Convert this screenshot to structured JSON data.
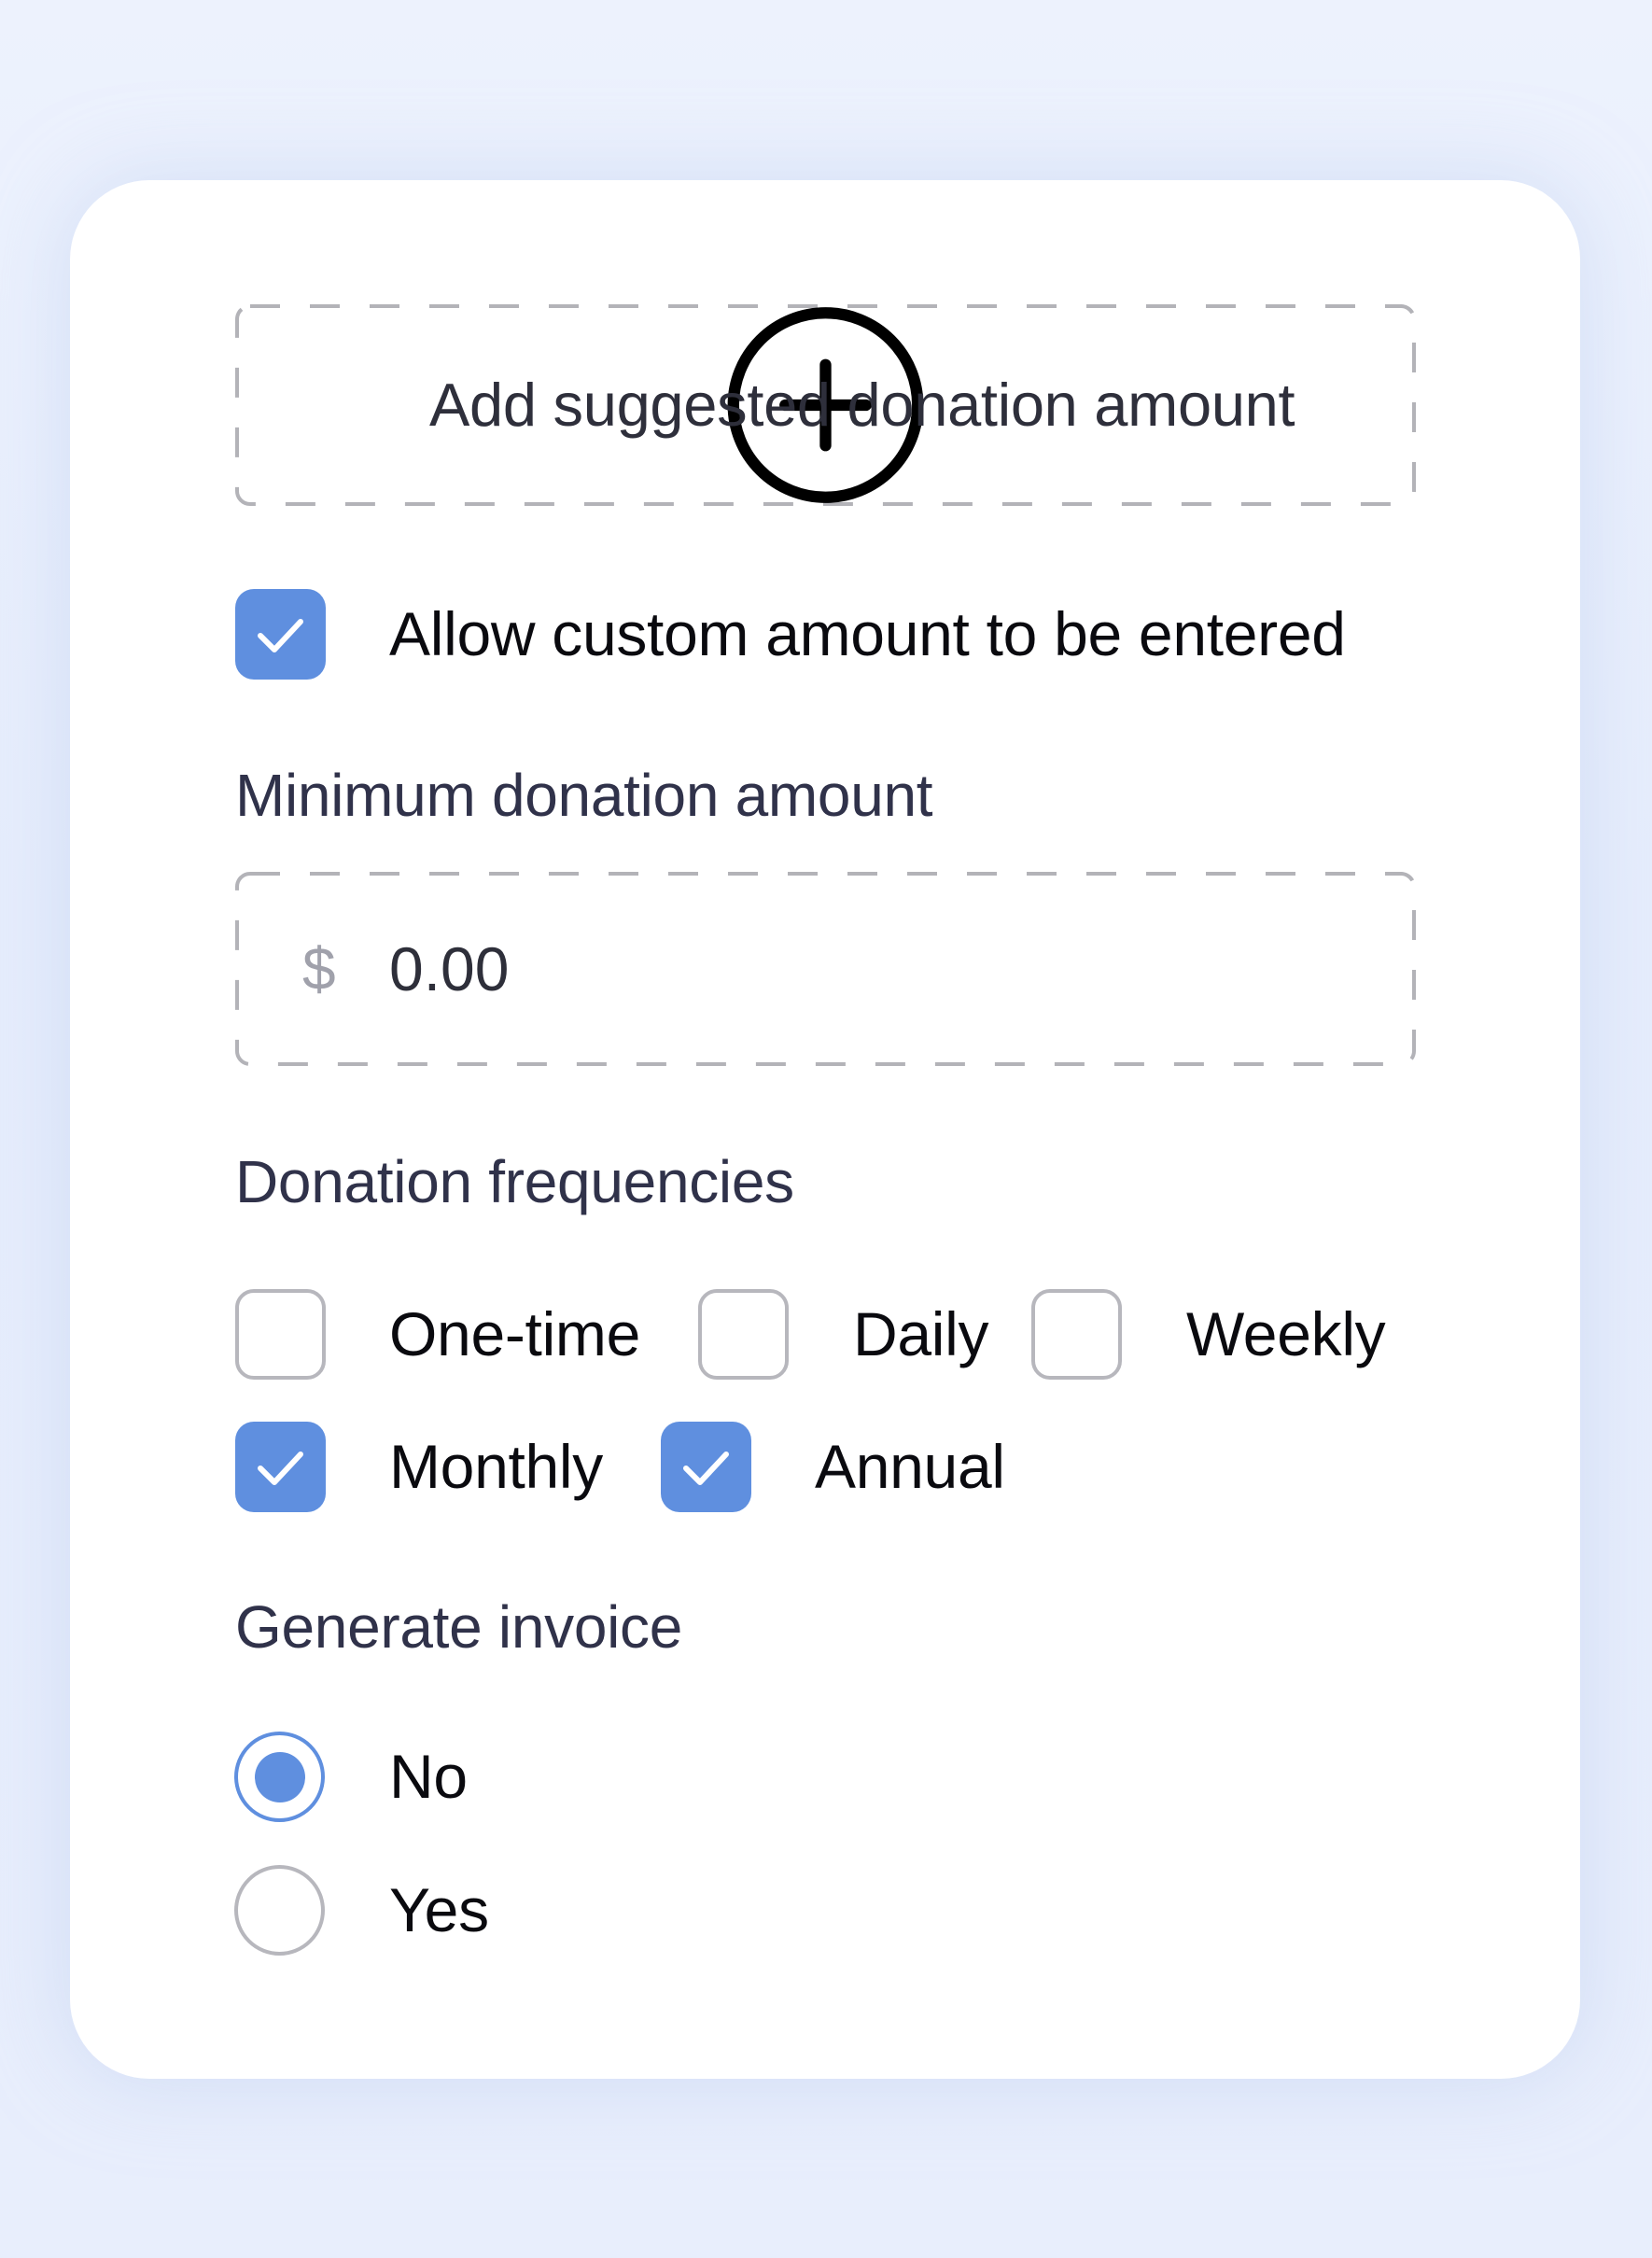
{
  "suggested_amount": {
    "add_label": "Add suggested donation amount",
    "icon": "plus-circle-icon"
  },
  "custom_amount": {
    "label": "Allow custom amount to be entered",
    "checked": true
  },
  "minimum_amount": {
    "heading": "Minimum donation amount",
    "currency_symbol": "$",
    "value": "0.00"
  },
  "frequencies": {
    "heading": "Donation frequencies",
    "options": [
      {
        "label": "One-time",
        "checked": false
      },
      {
        "label": "Daily",
        "checked": false
      },
      {
        "label": "Weekly",
        "checked": false
      },
      {
        "label": "Monthly",
        "checked": true
      },
      {
        "label": "Annual",
        "checked": true
      }
    ]
  },
  "invoice": {
    "heading": "Generate invoice",
    "options": [
      {
        "label": "No",
        "selected": true
      },
      {
        "label": "Yes",
        "selected": false
      }
    ]
  },
  "colors": {
    "accent": "#5f8fdf",
    "unchecked_border": "#b7b7bd",
    "background": "#e8eefc"
  }
}
